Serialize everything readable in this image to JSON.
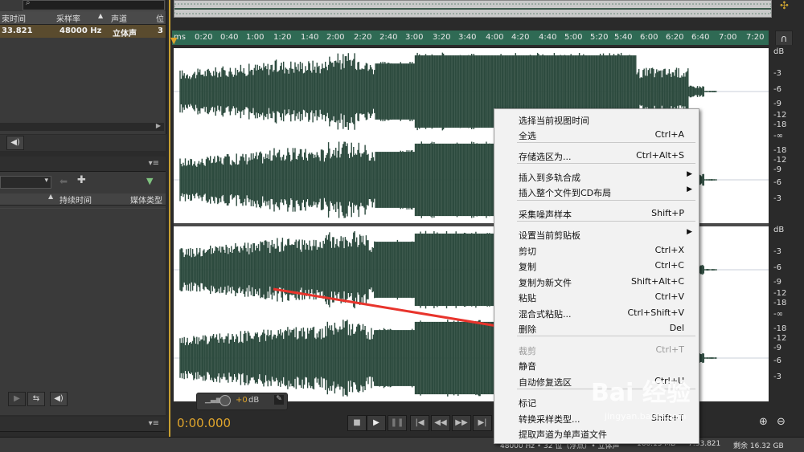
{
  "files_panel": {
    "columns": [
      "束时间",
      "采样率",
      "声道",
      "位"
    ],
    "row": {
      "end_time": "33.821",
      "sample_rate": "48000 Hz",
      "channels": "立体声",
      "bits": "3"
    }
  },
  "media_panel": {
    "columns": [
      "持续时间",
      "媒体类型"
    ]
  },
  "timeline": {
    "ticks": [
      "ms",
      "0:20",
      "0:40",
      "1:00",
      "1:20",
      "1:40",
      "2:00",
      "2:20",
      "2:40",
      "3:00",
      "3:20",
      "3:40",
      "4:00",
      "4:20",
      "4:40",
      "5:00",
      "5:20",
      "5:40",
      "6:00",
      "6:20",
      "6:40",
      "7:00",
      "7:20"
    ]
  },
  "db_scale": {
    "labels": [
      "dB",
      "-3",
      "-6",
      "-9",
      "-12",
      "-18",
      "-∞",
      "-18",
      "-12",
      "-9",
      "-6",
      "-3"
    ]
  },
  "transport": {
    "timecode": "0:00.000"
  },
  "volume_hud": {
    "value": "+0",
    "unit": "dB"
  },
  "context_menu": {
    "items": [
      {
        "label": "选择当前视图时间",
        "shortcut": ""
      },
      {
        "label": "全选",
        "shortcut": "Ctrl+A"
      },
      {
        "label": "存储选区为...",
        "shortcut": "Ctrl+Alt+S"
      },
      {
        "label": "插入到多轨合成",
        "shortcut": "",
        "submenu": true
      },
      {
        "label": "插入整个文件到CD布局",
        "shortcut": "",
        "submenu": true
      },
      {
        "label": "采集噪声样本",
        "shortcut": "Shift+P"
      },
      {
        "label": "设置当前剪贴板",
        "shortcut": "",
        "submenu": true
      },
      {
        "label": "剪切",
        "shortcut": "Ctrl+X"
      },
      {
        "label": "复制",
        "shortcut": "Ctrl+C"
      },
      {
        "label": "复制为新文件",
        "shortcut": "Shift+Alt+C"
      },
      {
        "label": "粘贴",
        "shortcut": "Ctrl+V"
      },
      {
        "label": "混合式粘贴...",
        "shortcut": "Ctrl+Shift+V"
      },
      {
        "label": "删除",
        "shortcut": "Del"
      },
      {
        "label": "裁剪",
        "shortcut": "Ctrl+T",
        "disabled": true
      },
      {
        "label": "静音",
        "shortcut": ""
      },
      {
        "label": "自动修复选区",
        "shortcut": "Ctrl+U"
      },
      {
        "label": "标记",
        "shortcut": ""
      },
      {
        "label": "转换采样类型...",
        "shortcut": "Shift+T"
      },
      {
        "label": "提取声道为单声道文件",
        "shortcut": ""
      }
    ]
  },
  "status": {
    "format": "48000 Hz • 32 位（浮点）• 立体声",
    "size": "160.15 MB",
    "duration": "7:33.821",
    "free": "剩余 16.32 GB"
  },
  "watermark": {
    "brand": "Bai 经验",
    "url": "jingyan.baidu.com"
  },
  "colors": {
    "waveform": "#2d4b3f",
    "accent": "#e0a52c",
    "timeline": "#2f6a54",
    "arrow": "#e8342c"
  }
}
